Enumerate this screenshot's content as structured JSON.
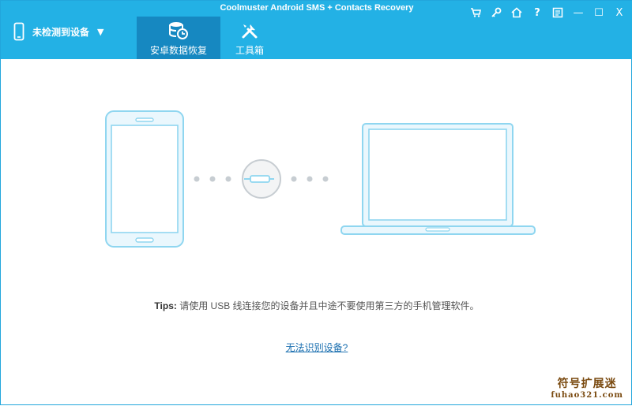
{
  "window": {
    "title": "Coolmuster Android SMS + Contacts Recovery"
  },
  "device": {
    "status_label": "未检测到设备"
  },
  "tabs": [
    {
      "label": "安卓数据恢复",
      "active": true
    },
    {
      "label": "工具箱",
      "active": false
    }
  ],
  "window_controls": [
    "cart-icon",
    "key-icon",
    "home-icon",
    "help-icon",
    "feedback-icon",
    "minimize-icon",
    "maximize-icon",
    "close-icon"
  ],
  "window_control_glyphs": {
    "help": "?",
    "minimize": "—",
    "maximize": "☐",
    "close": "X"
  },
  "illustration": {
    "phone": "phone-icon",
    "usb_connector": "usb-cable-icon",
    "laptop": "laptop-icon"
  },
  "tips": {
    "prefix": "Tips:",
    "text": " 请使用 USB 线连接您的设备并且中途不要使用第三方的手机管理软件。"
  },
  "help_link": "无法识别设备?",
  "watermark": {
    "line1": "符号扩展迷",
    "line2": "fuhao321.com"
  },
  "colors": {
    "header": "#23b1e5",
    "active_tab": "#1688c1",
    "illustration_stroke": "#8fd6f0",
    "illustration_fill": "#eaf7fd",
    "link": "#1a6fb0"
  }
}
